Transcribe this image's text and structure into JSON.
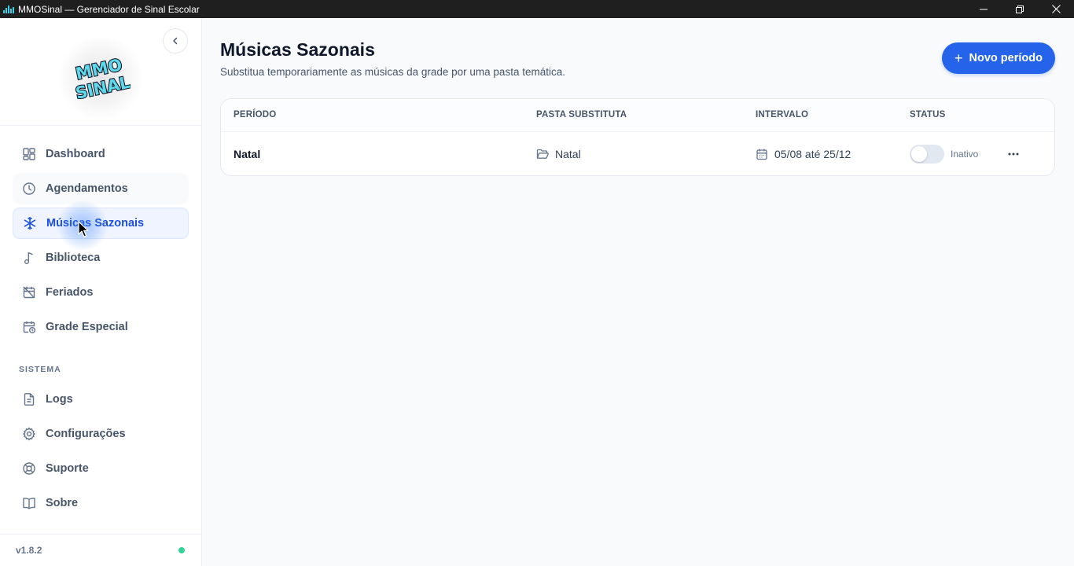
{
  "window": {
    "title": "MMOSinal — Gerenciador de Sinal Escolar"
  },
  "sidebar": {
    "logo_text": "MMO SINAL",
    "nav_items": [
      {
        "label": "Dashboard",
        "icon": "dashboard-icon"
      },
      {
        "label": "Agendamentos",
        "icon": "clock-icon"
      },
      {
        "label": "Músicas Sazonais",
        "icon": "snowflake-icon",
        "active": true
      },
      {
        "label": "Biblioteca",
        "icon": "music-note-icon"
      },
      {
        "label": "Feriados",
        "icon": "calendar-off-icon"
      },
      {
        "label": "Grade Especial",
        "icon": "calendar-clock-icon"
      }
    ],
    "section_label": "SISTEMA",
    "system_items": [
      {
        "label": "Logs",
        "icon": "file-text-icon"
      },
      {
        "label": "Configurações",
        "icon": "gear-icon"
      },
      {
        "label": "Suporte",
        "icon": "lifebuoy-icon"
      },
      {
        "label": "Sobre",
        "icon": "book-open-icon"
      }
    ],
    "version": "v1.8.2",
    "status_color": "#34d399"
  },
  "main": {
    "title": "Músicas Sazonais",
    "subtitle": "Substitua temporariamente as músicas da grade por uma pasta temática.",
    "new_button_label": "Novo período",
    "table": {
      "headers": [
        "PERÍODO",
        "PASTA SUBSTITUTA",
        "INTERVALO",
        "STATUS"
      ],
      "rows": [
        {
          "period": "Natal",
          "folder": "Natal",
          "interval": "05/08 até 25/12",
          "status": "Inativo",
          "enabled": false
        }
      ]
    }
  },
  "colors": {
    "accent": "#2563eb",
    "active_text": "#1d4ed8",
    "active_bg": "#eff4ff"
  }
}
